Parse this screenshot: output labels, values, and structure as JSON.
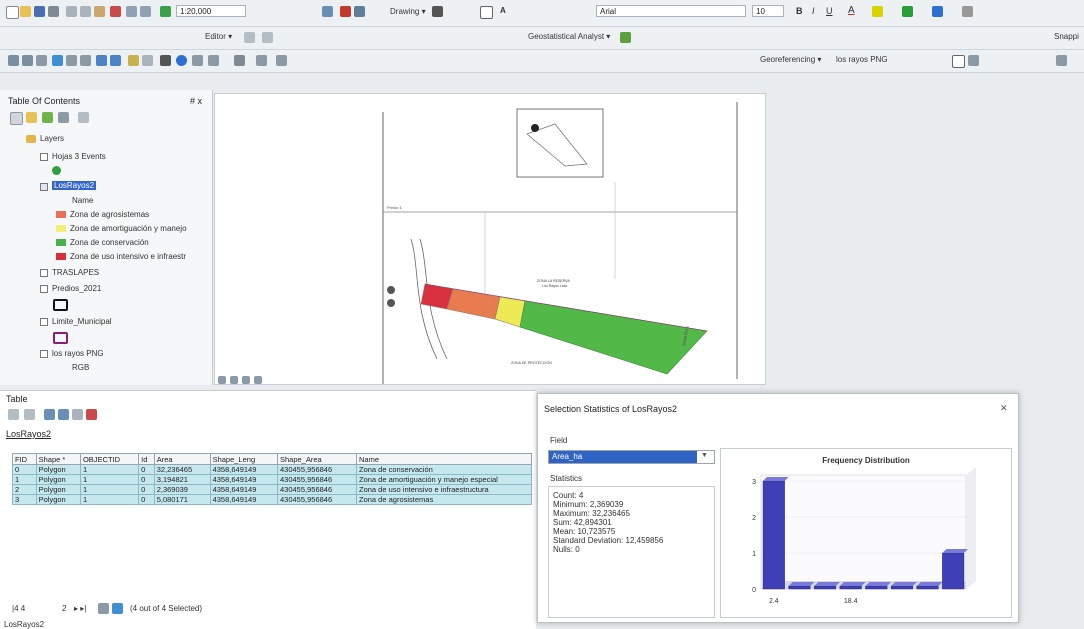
{
  "toolbar": {
    "scale": "1:20,000",
    "editor_label": "Editor ▾",
    "drawing_label": "Drawing ▾",
    "font_name": "Arial",
    "font_size": "10",
    "geostat_label": "Geostatistical Analyst ▾",
    "georef_label": "Georeferencing ▾",
    "georef_layer": "los rayos PNG",
    "snapping_label": "Snappi"
  },
  "toc": {
    "title": "Table Of Contents",
    "pin": "# x",
    "layers_label": "Layers",
    "items": [
      {
        "label": "Hojas 3 Events"
      },
      {
        "label": "LosRayos2"
      },
      {
        "label": "Name"
      },
      {
        "label": "Zona de agrosistemas",
        "color": "#e8705b"
      },
      {
        "label": "Zona de amortiguación y manejo",
        "color": "#f2ef7a"
      },
      {
        "label": "Zona de conservación",
        "color": "#4caf50"
      },
      {
        "label": "Zona de uso intensivo e infraestr",
        "color": "#d62f3a"
      },
      {
        "label": "TRASLAPES"
      },
      {
        "label": "Predios_2021"
      },
      {
        "label": "Limite_Municipal"
      },
      {
        "label": "los rayos PNG"
      },
      {
        "label": "RGB"
      }
    ]
  },
  "map": {
    "zone_colors": {
      "red": "#d8303f",
      "orange": "#e87c4f",
      "yellow": "#eeea55",
      "green": "#52b848"
    },
    "lbl_a": "Predio 1",
    "lbl_b": "ZONA LA RESERVA",
    "lbl_c": "Los Rayos Ltda",
    "lbl_d": "ZONA DE PROTECCIÓN",
    "lbl_e": "ZONA ESTE"
  },
  "table": {
    "panel_title": "Table",
    "layer_name": "LosRayos2",
    "columns": [
      "FID",
      "Shape *",
      "OBJECTID",
      "Id",
      "Area",
      "Shape_Leng",
      "Shape_Area",
      "Name"
    ],
    "rows": [
      [
        "0",
        "Polygon",
        "1",
        "0",
        "32,236465",
        "4358,649149",
        "430455,956846",
        "Zona de conservación"
      ],
      [
        "1",
        "Polygon",
        "1",
        "0",
        "3,194821",
        "4358,649149",
        "430455,956846",
        "Zona de amortiguación y manejo especial"
      ],
      [
        "2",
        "Polygon",
        "1",
        "0",
        "2,369039",
        "4358,649149",
        "430455,956846",
        "Zona de uso intensivo e infraestructura"
      ],
      [
        "3",
        "Polygon",
        "1",
        "0",
        "5,080171",
        "4358,649149",
        "430455,956846",
        "Zona de agrosistemas"
      ]
    ],
    "nav_first": "|4  4",
    "nav_page": "2",
    "nav_last": "▸  ▸|",
    "selected_text": "(4 out of 4 Selected)",
    "tab_label": "LosRayos2"
  },
  "dialog": {
    "title": "Selection Statistics of LosRayos2",
    "close": "✕",
    "field_label": "Field",
    "field_value": "Area_ha",
    "stats_label": "Statistics",
    "stats": [
      {
        "k": "Count:",
        "v": "4"
      },
      {
        "k": "Minimum:",
        "v": "2,369039"
      },
      {
        "k": "Maximum:",
        "v": "32,236465"
      },
      {
        "k": "Sum:",
        "v": "42,894301"
      },
      {
        "k": "Mean:",
        "v": "10,723575"
      },
      {
        "k": "Standard Deviation:",
        "v": "12,459856"
      },
      {
        "k": "Nulls:",
        "v": "0"
      }
    ]
  },
  "chart_data": {
    "type": "bar",
    "title": "Frequency Distribution",
    "categories": [
      "1",
      "2",
      "3",
      "4",
      "5",
      "6",
      "7",
      "8"
    ],
    "values": [
      3,
      0,
      0,
      0,
      0,
      0,
      0,
      1
    ],
    "ylim": [
      0,
      3
    ],
    "yticks": [
      "0",
      "1",
      "2",
      "3"
    ],
    "xticks": [
      "2.4",
      "18.4"
    ],
    "bar_color": "#3f3fb8"
  }
}
